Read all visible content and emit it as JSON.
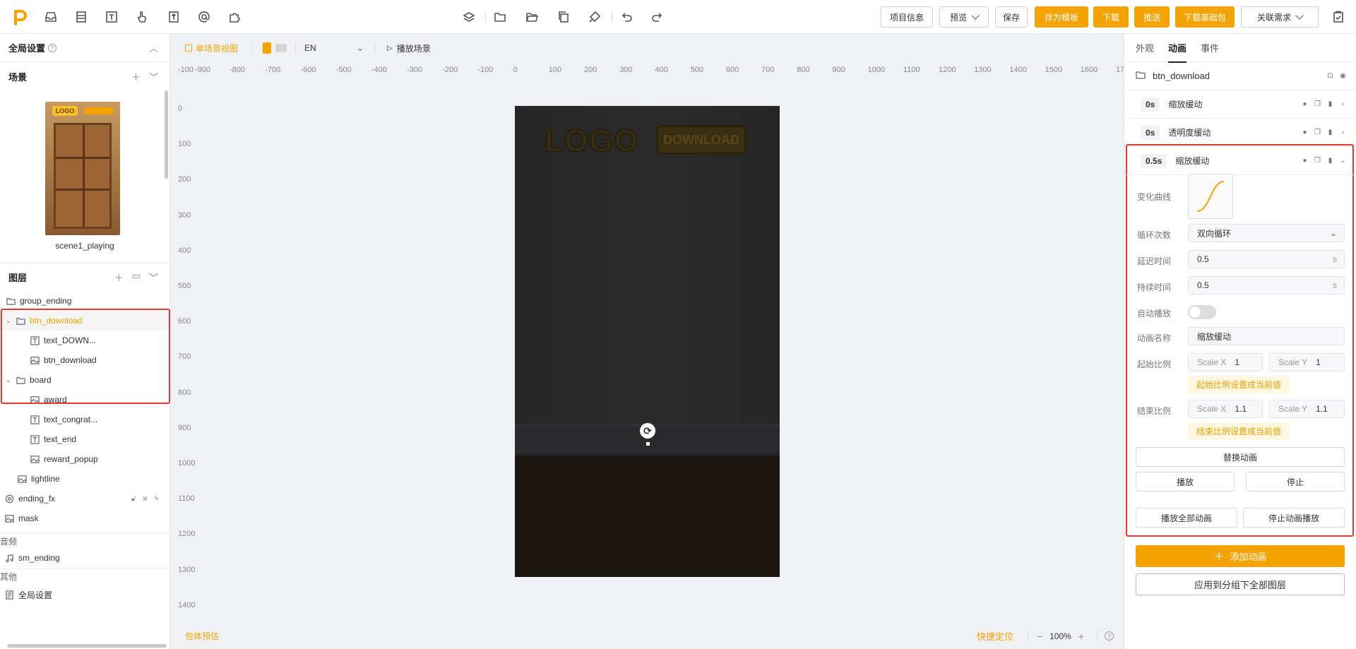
{
  "toolbar": {
    "project_info": "项目信息",
    "preview": "预览",
    "save": "保存",
    "save_template": "存为模板",
    "download": "下载",
    "push": "推送",
    "download_base": "下载基础包",
    "link_req": "关联需求"
  },
  "left": {
    "global_settings": "全局设置",
    "scene_header": "场景",
    "scene_name": "scene1_playing",
    "layers_header": "图层",
    "layers": [
      {
        "name": "group_ending",
        "type": "folder"
      },
      {
        "name": "btn_download",
        "type": "folder"
      },
      {
        "name": "text_DOWN...",
        "type": "text"
      },
      {
        "name": "btn_download",
        "type": "image"
      },
      {
        "name": "board",
        "type": "folder"
      },
      {
        "name": "award",
        "type": "image"
      },
      {
        "name": "text_congrat...",
        "type": "text"
      },
      {
        "name": "text_end",
        "type": "text"
      },
      {
        "name": "reward_popup",
        "type": "image"
      },
      {
        "name": "lightline",
        "type": "image"
      },
      {
        "name": "ending_fx",
        "type": "fx"
      },
      {
        "name": "mask",
        "type": "image"
      }
    ],
    "audio_header": "音频",
    "audio_item": "sm_ending",
    "other_header": "其他",
    "other_item": "全局设置"
  },
  "canvas": {
    "view_label": "单场景视图",
    "lang": "EN",
    "play_scene": "播放场景",
    "ruler_h": [
      "-100",
      "-900",
      "-800",
      "-700",
      "-600",
      "-500",
      "-400",
      "-300",
      "-200",
      "-100",
      "0",
      "100",
      "200",
      "300",
      "400",
      "500",
      "600",
      "700",
      "800",
      "900",
      "1000",
      "1100",
      "1200",
      "1300",
      "1400",
      "1500",
      "1600",
      "17"
    ],
    "ruler_v": [
      "0",
      "100",
      "200",
      "300",
      "400",
      "500",
      "600",
      "700",
      "800",
      "900",
      "1000",
      "1100",
      "1200",
      "1300",
      "1400"
    ],
    "phone": {
      "logo": "LOGO",
      "download": "DOWNLOAD"
    },
    "size_estimate": "包体预估",
    "quick_locate": "快捷定位",
    "zoom": "100%"
  },
  "right": {
    "tabs": [
      "外观",
      "动画",
      "事件"
    ],
    "object_name": "btn_download",
    "anims": [
      {
        "dur": "0s",
        "name": "缩放缓动"
      },
      {
        "dur": "0s",
        "name": "透明度缓动"
      },
      {
        "dur": "0.5s",
        "name": "缩放缓动"
      }
    ],
    "form": {
      "curve_label": "变化曲线",
      "loop_label": "循环次数",
      "loop_value": "双向循环",
      "delay_label": "延迟时间",
      "delay_value": "0.5",
      "duration_label": "持续时间",
      "duration_value": "0.5",
      "unit": "s",
      "autoplay_label": "自动播放",
      "anim_name_label": "动画名称",
      "anim_name_value": "缩放缓动",
      "start_label": "起始比例",
      "scale_x_label": "Scale X",
      "scale_y_label": "Scale Y",
      "start_x": "1",
      "start_y": "1",
      "start_hint": "起始比例设置成当前值",
      "end_label": "结束比例",
      "end_x": "1.1",
      "end_y": "1.1",
      "end_hint": "结束比例设置成当前值",
      "replace": "替换动画",
      "play": "播放",
      "stop": "停止"
    },
    "play_all": "播放全部动画",
    "stop_all": "停止动画播放",
    "add_anim": "添加动画",
    "apply_group": "应用到分组下全部图层"
  },
  "colors": {
    "accent": "#f5a300",
    "highlight": "#e53935"
  }
}
